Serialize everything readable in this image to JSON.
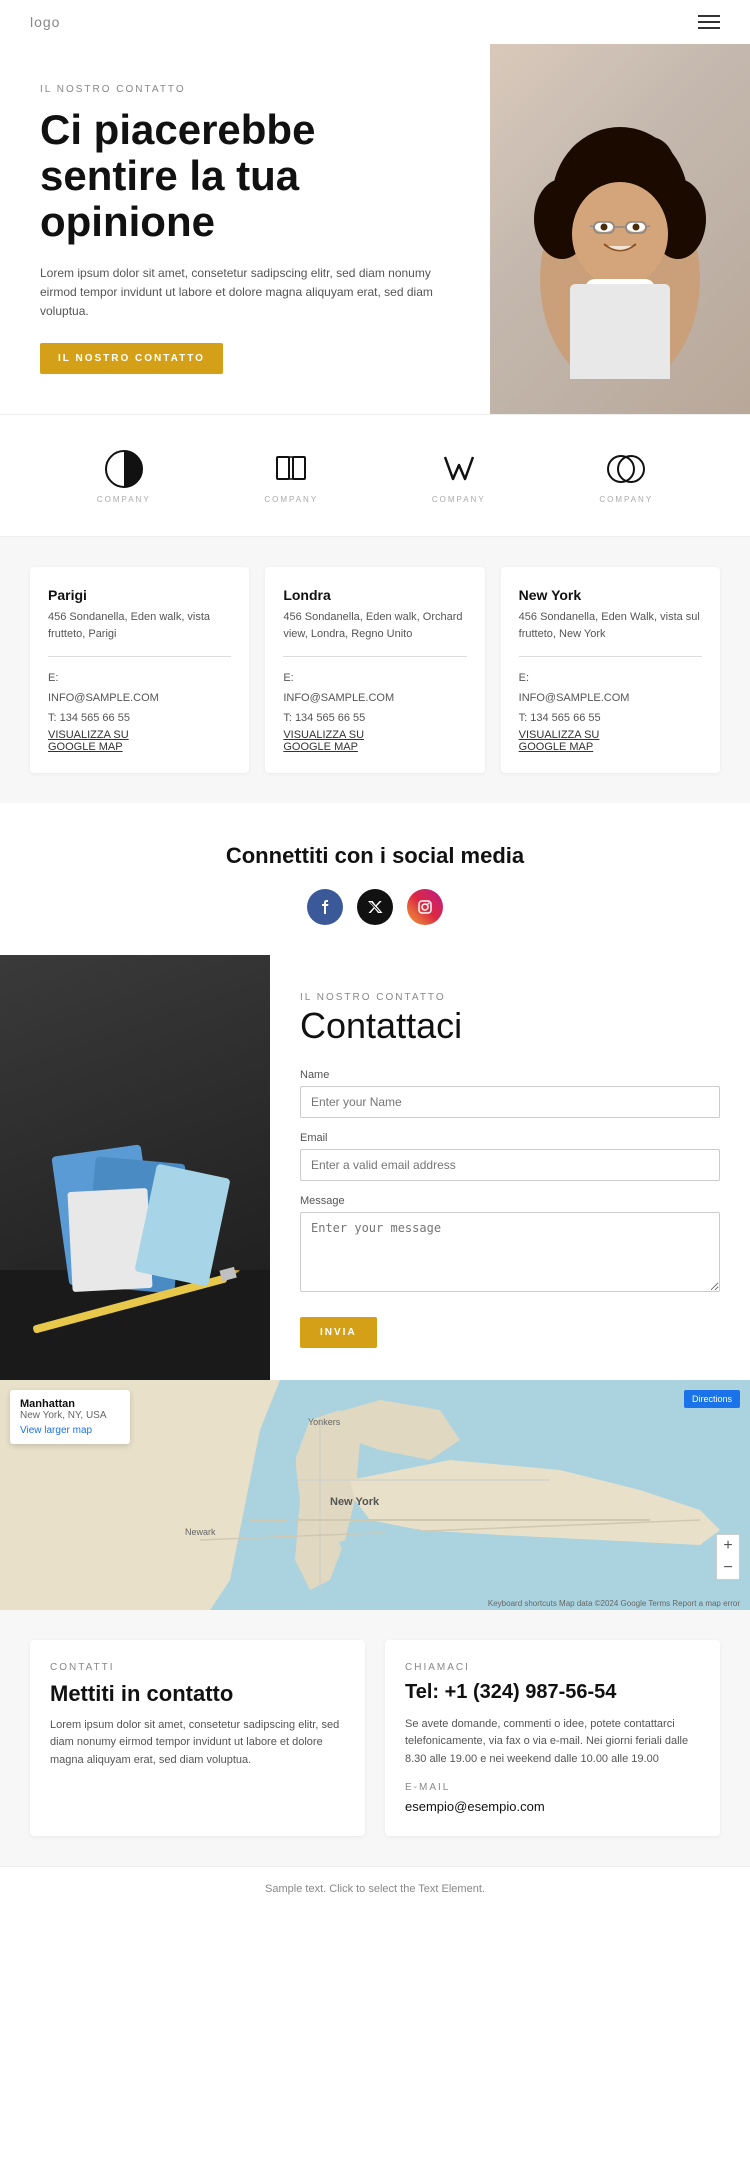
{
  "header": {
    "logo": "logo"
  },
  "hero": {
    "section_label": "IL NOSTRO CONTATTO",
    "title": "Ci piacerebbe sentire la tua opinione",
    "description": "Lorem ipsum dolor sit amet, consetetur sadipscing elitr, sed diam nonumy eirmod tempor invidunt ut labore et dolore magna aliquyam erat, sed diam voluptua.",
    "cta_button": "IL NOSTRO CONTATTO"
  },
  "logos": [
    {
      "id": "logo1",
      "label": "COMPANY"
    },
    {
      "id": "logo2",
      "label": "COMPANY"
    },
    {
      "id": "logo3",
      "label": "COMPANY"
    },
    {
      "id": "logo4",
      "label": "COMPANY"
    }
  ],
  "offices": [
    {
      "city": "Parigi",
      "address": "456 Sondanella, Eden walk, vista frutteto, Parigi",
      "email_label": "E:",
      "email": "INFO@SAMPLE.COM",
      "phone": "T: 134 565 66 55",
      "map_link": "VISUALIZZA SU\nGOOGLE MAP"
    },
    {
      "city": "Londra",
      "address": "456 Sondanella, Eden walk, Orchard view, Londra, Regno Unito",
      "email_label": "E:",
      "email": "INFO@SAMPLE.COM",
      "phone": "T: 134 565 66 55",
      "map_link": "VISUALIZZA SU\nGOOGLE MAP"
    },
    {
      "city": "New York",
      "address": "456 Sondanella, Eden Walk, vista sul frutteto, New York",
      "email_label": "E:",
      "email": "INFO@SAMPLE.COM",
      "phone": "T: 134 565 66 55",
      "map_link": "VISUALIZZA SU\nGOOGLE MAP"
    }
  ],
  "social": {
    "title": "Connettiti con i social media"
  },
  "contact_form": {
    "section_label": "IL NOSTRO CONTATTO",
    "title": "Contattaci",
    "name_label": "Name",
    "name_placeholder": "Enter your Name",
    "email_label": "Email",
    "email_placeholder": "Enter a valid email address",
    "message_label": "Message",
    "message_placeholder": "Enter your message",
    "submit_button": "INVIA"
  },
  "map": {
    "location_title": "Manhattan",
    "location_sub": "New York, NY, USA",
    "view_larger": "View larger map",
    "directions": "Directions",
    "copyright": "Keyboard shortcuts  Map data ©2024 Google  Terms  Report a map error"
  },
  "bottom_info": {
    "card1": {
      "label": "CONTATTI",
      "title": "Mettiti in contatto",
      "description": "Lorem ipsum dolor sit amet, consetetur sadipscing elitr, sed diam nonumy eirmod tempor invidunt ut labore et dolore magna aliquyam erat, sed diam voluptua."
    },
    "card2": {
      "label": "CHIAMACI",
      "phone": "Tel: +1 (324) 987-56-54",
      "text": "Se avete domande, commenti o idee, potete contattarci telefonicamente, via fax o via e-mail. Nei giorni feriali dalle 8.30 alle 19.00 e nei weekend dalle 10.00 alle 19.00",
      "email_label": "E-MAIL",
      "email": "esempio@esempio.com"
    }
  },
  "footer": {
    "sample_text": "Sample text. Click to select the Text Element."
  }
}
